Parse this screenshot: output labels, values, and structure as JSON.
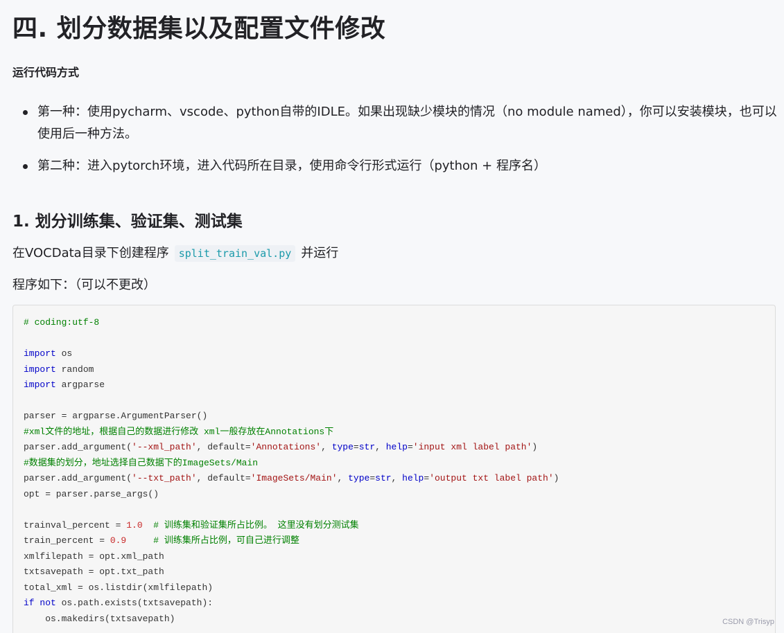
{
  "heading": "四. 划分数据集以及配置文件修改",
  "subheading": "运行代码方式",
  "bullets": [
    "第一种：使用pycharm、vscode、python自带的IDLE。如果出现缺少模块的情况（no module named），你可以安装模块，也可以使用后一种方法。",
    "第二种：进入pytorch环境，进入代码所在目录，使用命令行形式运行（python + 程序名）"
  ],
  "section_title": "1. 划分训练集、验证集、测试集",
  "intro": {
    "prefix": "在VOCData目录下创建程序",
    "filename": "split_train_val.py",
    "suffix": "并运行"
  },
  "program_note": "程序如下：（可以不更改）",
  "code": {
    "l1_com": "# coding:utf-8",
    "l3_kw": "import",
    "l3_rest": " os",
    "l4_kw": "import",
    "l4_rest": " random",
    "l5_kw": "import",
    "l5_rest": " argparse",
    "l7": "parser = argparse.ArgumentParser()",
    "l8_com": "#xml文件的地址，根据自己的数据进行修改 xml一般存放在Annotations下",
    "l9_a": "parser.add_argument(",
    "l9_s1": "'--xml_path'",
    "l9_b": ", default=",
    "l9_s2": "'Annotations'",
    "l9_c": ", ",
    "l9_k1": "type",
    "l9_d": "=",
    "l9_k2": "str",
    "l9_e": ", ",
    "l9_k3": "help",
    "l9_f": "=",
    "l9_s3": "'input xml label path'",
    "l9_g": ")",
    "l10_com": "#数据集的划分，地址选择自己数据下的ImageSets/Main",
    "l11_a": "parser.add_argument(",
    "l11_s1": "'--txt_path'",
    "l11_b": ", default=",
    "l11_s2": "'ImageSets/Main'",
    "l11_c": ", ",
    "l11_k1": "type",
    "l11_d": "=",
    "l11_k2": "str",
    "l11_e": ", ",
    "l11_k3": "help",
    "l11_f": "=",
    "l11_s3": "'output txt label path'",
    "l11_g": ")",
    "l12": "opt = parser.parse_args()",
    "l14_a": "trainval_percent = ",
    "l14_n": "1.0",
    "l14_sp": "  ",
    "l14_com": "# 训练集和验证集所占比例。 这里没有划分测试集",
    "l15_a": "train_percent = ",
    "l15_n": "0.9",
    "l15_sp": "     ",
    "l15_com": "# 训练集所占比例，可自己进行调整",
    "l16": "xmlfilepath = opt.xml_path",
    "l17": "txtsavepath = opt.txt_path",
    "l18": "total_xml = os.listdir(xmlfilepath)",
    "l19_kw1": "if",
    "l19_sp": " ",
    "l19_kw2": "not",
    "l19_rest": " os.path.exists(txtsavepath):",
    "l20": "    os.makedirs(txtsavepath)"
  },
  "watermark": "CSDN @Trisyp"
}
